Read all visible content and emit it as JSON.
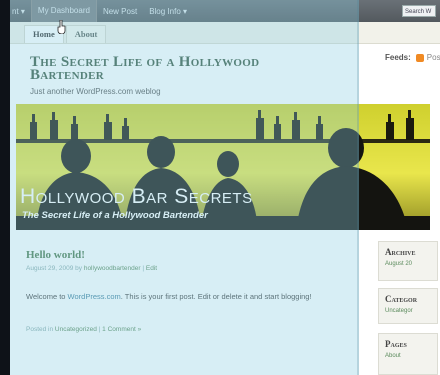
{
  "adminbar": {
    "items": [
      "nt ▾",
      "My Dashboard",
      "New Post",
      "Blog Info ▾"
    ],
    "search_label": "Search W"
  },
  "nav": {
    "tabs": [
      "Home",
      "About"
    ]
  },
  "header": {
    "title": "The Secret Life of a Hollywood Bartender",
    "tagline": "Just another WordPress.com weblog",
    "feeds_label": "Feeds:",
    "feeds_posts": "Pos"
  },
  "banner": {
    "title": "Hollywood Bar Secrets",
    "subtitle": "The Secret Life of a Hollywood Bartender"
  },
  "post": {
    "title": "Hello world!",
    "date": "August 29, 2009 by",
    "author": "hollywoodbartender",
    "sep": "|",
    "edit": "Edit",
    "body_pre": "Welcome to ",
    "body_link": "WordPress.com",
    "body_post": ". This is your first post. Edit or delete it and start blogging!",
    "posted_in": "Posted in",
    "category": "Uncategorized",
    "comments": "1 Comment »"
  },
  "sidebar": {
    "archives": {
      "heading": "Archive",
      "item": "August 20"
    },
    "categories": {
      "heading": "Categor",
      "item": "Uncategor"
    },
    "pages": {
      "heading": "Pages",
      "item": "About"
    }
  },
  "colors": {
    "accent_green": "#4b7a4d",
    "banner_yellow": "#e7e44a",
    "adminbar": "#5f666b"
  }
}
